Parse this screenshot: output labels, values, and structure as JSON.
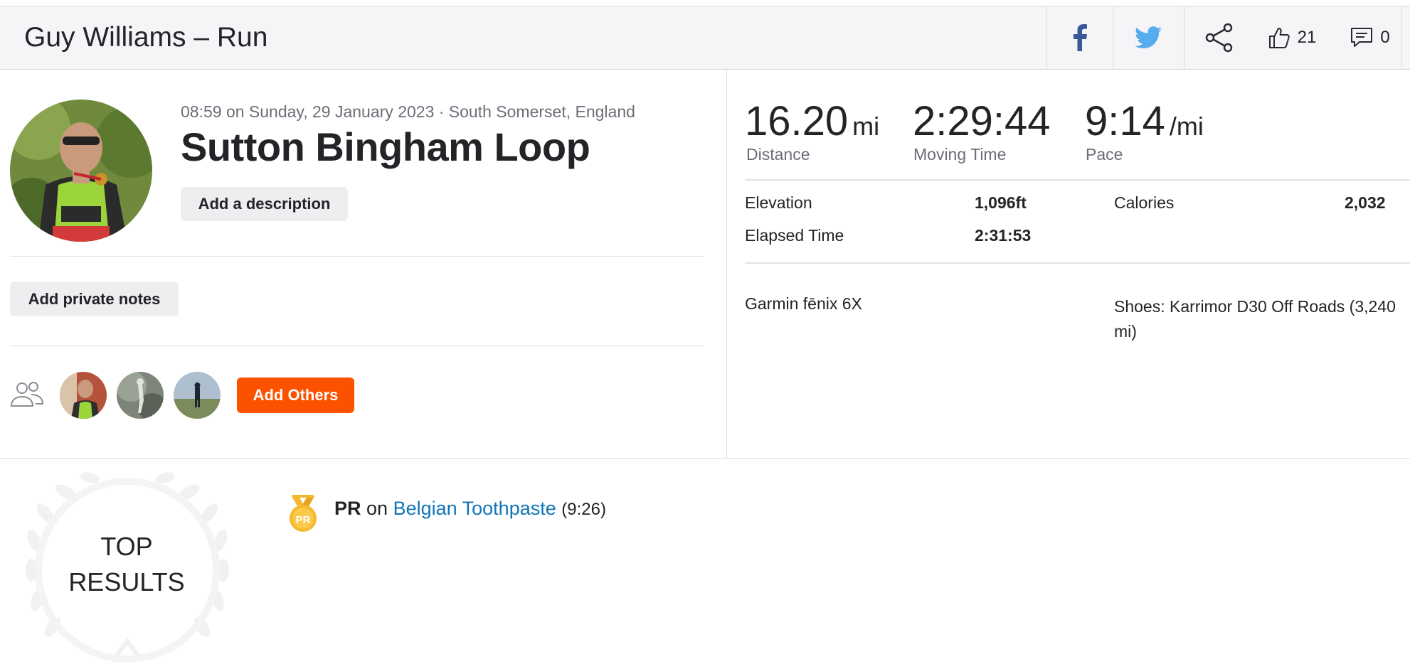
{
  "header": {
    "title": "Guy Williams – Run",
    "kudos_count": "21",
    "comments_count": "0"
  },
  "activity": {
    "meta": "08:59 on Sunday, 29 January 2023 · South Somerset, England",
    "name": "Sutton Bingham Loop",
    "add_description_label": "Add a description",
    "add_private_notes_label": "Add private notes",
    "add_others_label": "Add Others"
  },
  "stats": {
    "distance": {
      "value": "16.20",
      "unit": "mi",
      "label": "Distance"
    },
    "moving_time": {
      "value": "2:29:44",
      "label": "Moving Time"
    },
    "pace": {
      "value": "9:14",
      "unit": "/mi",
      "label": "Pace"
    }
  },
  "details": {
    "elevation": {
      "label": "Elevation",
      "value": "1,096ft"
    },
    "calories": {
      "label": "Calories",
      "value": "2,032"
    },
    "elapsed_time": {
      "label": "Elapsed Time",
      "value": "2:31:53"
    },
    "device": "Garmin fēnix 6X",
    "gear": "Shoes: Karrimor D30 Off Roads (3,240 mi)"
  },
  "top_results": {
    "label_line1": "TOP",
    "label_line2": "RESULTS",
    "medal_text": "PR",
    "items": [
      {
        "badge": "PR",
        "connector": " on ",
        "segment": "Belgian Toothpaste",
        "time": "(9:26)"
      }
    ]
  },
  "colors": {
    "brand_orange": "#fc5200",
    "link_blue": "#0f74b8",
    "facebook": "#3b5998",
    "twitter": "#55acee",
    "medal_gold": "#f5b82e"
  },
  "icons": {
    "facebook": "facebook-icon",
    "twitter": "twitter-icon",
    "share": "share-icon",
    "kudos": "thumbs-up-icon",
    "comments": "comment-icon",
    "group": "group-icon",
    "medal": "medal-icon",
    "laurel": "laurel-wreath-icon"
  }
}
